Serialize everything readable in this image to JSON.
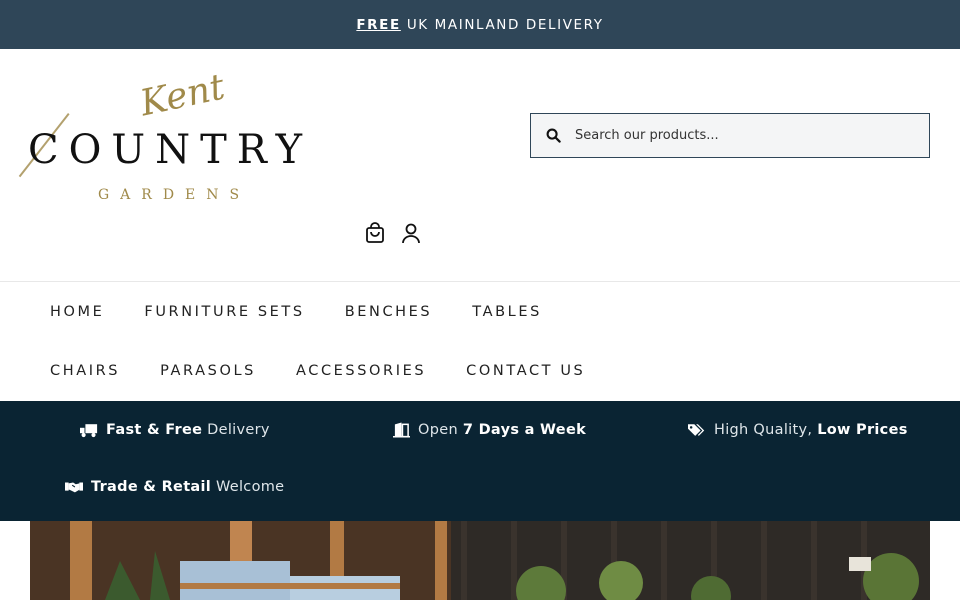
{
  "topbar": {
    "free": "FREE",
    "text": "UK MAINLAND DELIVERY"
  },
  "logo": {
    "kent": "Kent",
    "country": "COUNTRY",
    "gardens": "GARDENS"
  },
  "search": {
    "placeholder": "Search our products..."
  },
  "header_icons": [
    "cart-icon",
    "account-icon"
  ],
  "nav": {
    "home": "HOME",
    "furniture_sets": "FURNITURE SETS",
    "benches": "BENCHES",
    "tables": "TABLES",
    "chairs": "CHAIRS",
    "parasols": "PARASOLS",
    "accessories": "ACCESSORIES",
    "contact": "CONTACT US"
  },
  "usp": {
    "delivery": {
      "bold": "Fast & Free",
      "rest": "Delivery"
    },
    "open": {
      "pre": "Open",
      "bold": "7 Days a Week"
    },
    "quality": {
      "pre": "High Quality,",
      "bold": "Low Prices"
    },
    "trade": {
      "bold": "Trade & Retail",
      "rest": "Welcome"
    }
  },
  "colors": {
    "topbar": "#2f4658",
    "usp_bar": "#0a2433",
    "logo_gold": "#a08a4a"
  }
}
